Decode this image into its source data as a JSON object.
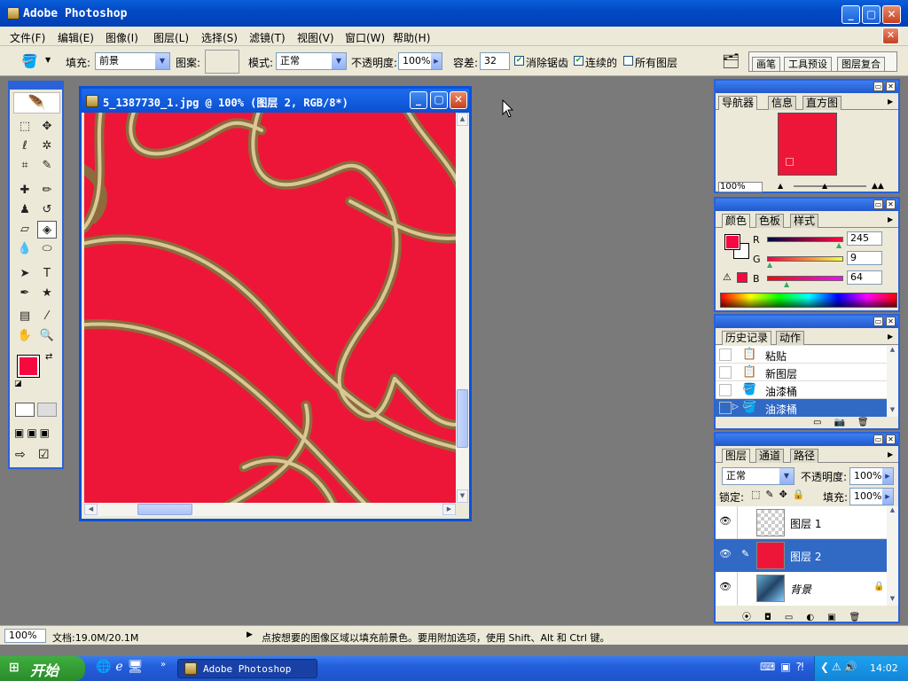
{
  "window": {
    "title": "Adobe Photoshop"
  },
  "menu": [
    "文件(F)",
    "编辑(E)",
    "图像(I)",
    "图层(L)",
    "选择(S)",
    "滤镜(T)",
    "视图(V)",
    "窗口(W)",
    "帮助(H)"
  ],
  "options": {
    "fill_label": "填充:",
    "fill_value": "前景",
    "pattern_label": "图案:",
    "mode_label": "模式:",
    "mode_value": "正常",
    "opacity_label": "不透明度:",
    "opacity_value": "100%",
    "tolerance_label": "容差:",
    "tolerance_value": "32",
    "antialias_label": "消除锯齿",
    "contiguous_label": "连续的",
    "all_layers_label": "所有图层",
    "tab_brush": "画笔",
    "tab_tool_presets": "工具预设",
    "tab_layer_comps": "图层复合"
  },
  "document": {
    "title": "5_1387730_1.jpg @ 100% (图层 2, RGB/8*)"
  },
  "navigator": {
    "tabs": [
      "导航器",
      "信息",
      "直方图"
    ],
    "zoom": "100%"
  },
  "color": {
    "tabs": [
      "颜色",
      "色板",
      "样式"
    ],
    "r_label": "R",
    "g_label": "G",
    "b_label": "B",
    "r": "245",
    "g": "9",
    "b": "64",
    "foreground": "#f50940"
  },
  "history": {
    "tabs": [
      "历史记录",
      "动作"
    ],
    "items": [
      "粘贴",
      "新图层",
      "油漆桶",
      "油漆桶"
    ],
    "selected_index": 3
  },
  "layers": {
    "tabs": [
      "图层",
      "通道",
      "路径"
    ],
    "blend_mode": "正常",
    "opacity_label": "不透明度:",
    "opacity": "100%",
    "lock_label": "锁定:",
    "fill_label": "填充:",
    "fill": "100%",
    "items": [
      {
        "name": "图层 1",
        "selected": false
      },
      {
        "name": "图层 2",
        "selected": true
      },
      {
        "name": "背景",
        "selected": false
      }
    ]
  },
  "status": {
    "zoom": "100%",
    "doc_info": "文档:19.0M/20.1M",
    "hint": "点按想要的图像区域以填充前景色。要用附加选项，使用 Shift、Alt 和 Ctrl 键。"
  },
  "taskbar": {
    "start": "开始",
    "task": "Adobe Photoshop",
    "time": "14:02"
  },
  "colors": {
    "canvas_red": "#ee1638",
    "xp_blue": "#0b52d6",
    "selected_row": "#316ac5"
  }
}
